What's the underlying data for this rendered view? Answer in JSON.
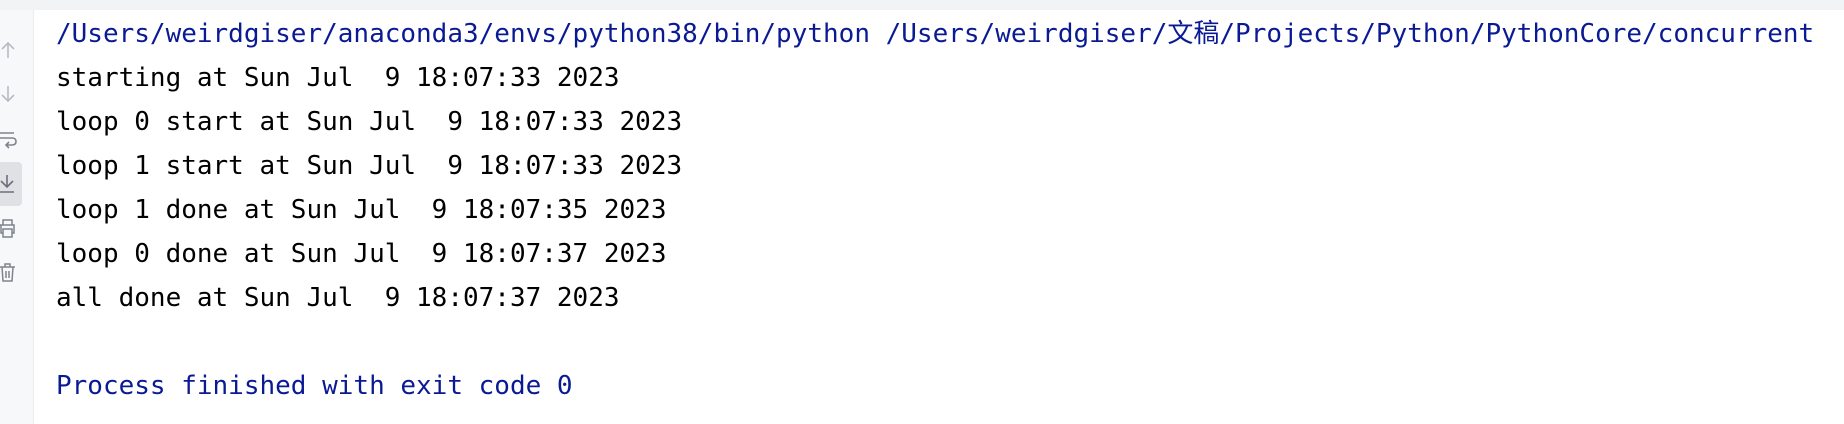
{
  "colors": {
    "command_text": "#0a1a93",
    "output_text": "#000000",
    "exit_text": "#0a1a93",
    "gutter_bg": "#f7f8fa",
    "active_tool_bg": "#dfe1e5"
  },
  "toolbar": {
    "items": [
      {
        "icon": "arrow-up-icon"
      },
      {
        "icon": "arrow-down-icon"
      },
      {
        "icon": "soft-wrap-icon"
      },
      {
        "icon": "scroll-to-end-icon",
        "active": true
      },
      {
        "icon": "print-icon"
      },
      {
        "icon": "trash-icon"
      }
    ]
  },
  "console": {
    "command": "/Users/weirdgiser/anaconda3/envs/python38/bin/python /Users/weirdgiser/文稿/Projects/Python/PythonCore/concurrent",
    "output": [
      "starting at Sun Jul  9 18:07:33 2023",
      "loop 0 start at Sun Jul  9 18:07:33 2023",
      "loop 1 start at Sun Jul  9 18:07:33 2023",
      "loop 1 done at Sun Jul  9 18:07:35 2023",
      "loop 0 done at Sun Jul  9 18:07:37 2023",
      "all done at Sun Jul  9 18:07:37 2023"
    ],
    "exit_message": "Process finished with exit code 0"
  }
}
